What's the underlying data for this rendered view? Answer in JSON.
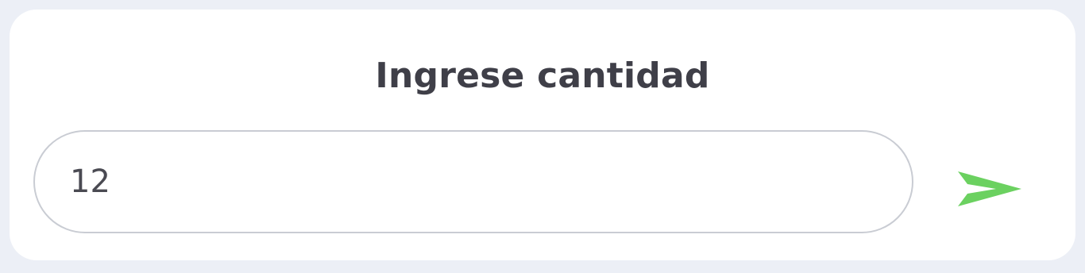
{
  "panel": {
    "title": "Ingrese cantidad",
    "quantity_value": "12",
    "send_icon": "send-icon",
    "accent_color": "#6bd160"
  }
}
